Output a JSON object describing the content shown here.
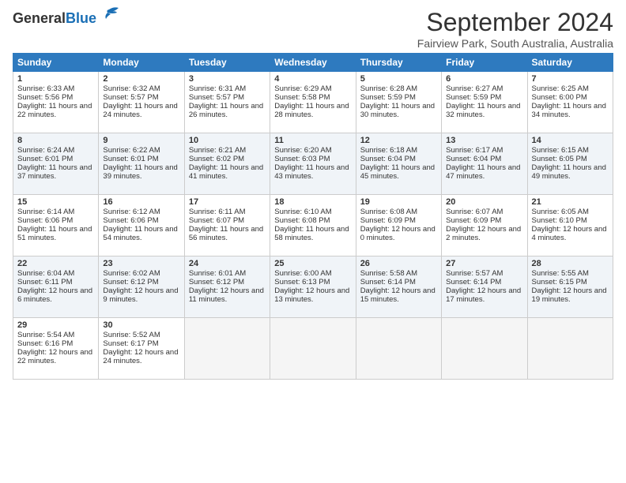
{
  "logo": {
    "line1": "General",
    "line2": "Blue"
  },
  "title": "September 2024",
  "location": "Fairview Park, South Australia, Australia",
  "headers": [
    "Sunday",
    "Monday",
    "Tuesday",
    "Wednesday",
    "Thursday",
    "Friday",
    "Saturday"
  ],
  "weeks": [
    [
      {
        "day": "1",
        "sunrise": "6:33 AM",
        "sunset": "5:56 PM",
        "daylight": "11 hours and 22 minutes."
      },
      {
        "day": "2",
        "sunrise": "6:32 AM",
        "sunset": "5:57 PM",
        "daylight": "11 hours and 24 minutes."
      },
      {
        "day": "3",
        "sunrise": "6:31 AM",
        "sunset": "5:57 PM",
        "daylight": "11 hours and 26 minutes."
      },
      {
        "day": "4",
        "sunrise": "6:29 AM",
        "sunset": "5:58 PM",
        "daylight": "11 hours and 28 minutes."
      },
      {
        "day": "5",
        "sunrise": "6:28 AM",
        "sunset": "5:59 PM",
        "daylight": "11 hours and 30 minutes."
      },
      {
        "day": "6",
        "sunrise": "6:27 AM",
        "sunset": "5:59 PM",
        "daylight": "11 hours and 32 minutes."
      },
      {
        "day": "7",
        "sunrise": "6:25 AM",
        "sunset": "6:00 PM",
        "daylight": "11 hours and 34 minutes."
      }
    ],
    [
      {
        "day": "8",
        "sunrise": "6:24 AM",
        "sunset": "6:01 PM",
        "daylight": "11 hours and 37 minutes."
      },
      {
        "day": "9",
        "sunrise": "6:22 AM",
        "sunset": "6:01 PM",
        "daylight": "11 hours and 39 minutes."
      },
      {
        "day": "10",
        "sunrise": "6:21 AM",
        "sunset": "6:02 PM",
        "daylight": "11 hours and 41 minutes."
      },
      {
        "day": "11",
        "sunrise": "6:20 AM",
        "sunset": "6:03 PM",
        "daylight": "11 hours and 43 minutes."
      },
      {
        "day": "12",
        "sunrise": "6:18 AM",
        "sunset": "6:04 PM",
        "daylight": "11 hours and 45 minutes."
      },
      {
        "day": "13",
        "sunrise": "6:17 AM",
        "sunset": "6:04 PM",
        "daylight": "11 hours and 47 minutes."
      },
      {
        "day": "14",
        "sunrise": "6:15 AM",
        "sunset": "6:05 PM",
        "daylight": "11 hours and 49 minutes."
      }
    ],
    [
      {
        "day": "15",
        "sunrise": "6:14 AM",
        "sunset": "6:06 PM",
        "daylight": "11 hours and 51 minutes."
      },
      {
        "day": "16",
        "sunrise": "6:12 AM",
        "sunset": "6:06 PM",
        "daylight": "11 hours and 54 minutes."
      },
      {
        "day": "17",
        "sunrise": "6:11 AM",
        "sunset": "6:07 PM",
        "daylight": "11 hours and 56 minutes."
      },
      {
        "day": "18",
        "sunrise": "6:10 AM",
        "sunset": "6:08 PM",
        "daylight": "11 hours and 58 minutes."
      },
      {
        "day": "19",
        "sunrise": "6:08 AM",
        "sunset": "6:09 PM",
        "daylight": "12 hours and 0 minutes."
      },
      {
        "day": "20",
        "sunrise": "6:07 AM",
        "sunset": "6:09 PM",
        "daylight": "12 hours and 2 minutes."
      },
      {
        "day": "21",
        "sunrise": "6:05 AM",
        "sunset": "6:10 PM",
        "daylight": "12 hours and 4 minutes."
      }
    ],
    [
      {
        "day": "22",
        "sunrise": "6:04 AM",
        "sunset": "6:11 PM",
        "daylight": "12 hours and 6 minutes."
      },
      {
        "day": "23",
        "sunrise": "6:02 AM",
        "sunset": "6:12 PM",
        "daylight": "12 hours and 9 minutes."
      },
      {
        "day": "24",
        "sunrise": "6:01 AM",
        "sunset": "6:12 PM",
        "daylight": "12 hours and 11 minutes."
      },
      {
        "day": "25",
        "sunrise": "6:00 AM",
        "sunset": "6:13 PM",
        "daylight": "12 hours and 13 minutes."
      },
      {
        "day": "26",
        "sunrise": "5:58 AM",
        "sunset": "6:14 PM",
        "daylight": "12 hours and 15 minutes."
      },
      {
        "day": "27",
        "sunrise": "5:57 AM",
        "sunset": "6:14 PM",
        "daylight": "12 hours and 17 minutes."
      },
      {
        "day": "28",
        "sunrise": "5:55 AM",
        "sunset": "6:15 PM",
        "daylight": "12 hours and 19 minutes."
      }
    ],
    [
      {
        "day": "29",
        "sunrise": "5:54 AM",
        "sunset": "6:16 PM",
        "daylight": "12 hours and 22 minutes."
      },
      {
        "day": "30",
        "sunrise": "5:52 AM",
        "sunset": "6:17 PM",
        "daylight": "12 hours and 24 minutes."
      },
      null,
      null,
      null,
      null,
      null
    ]
  ]
}
